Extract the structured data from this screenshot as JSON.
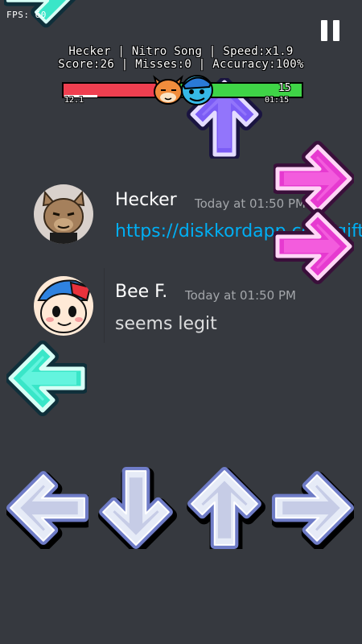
{
  "hud": {
    "fps": "FPS: 60",
    "line1": "Hecker | Nitro Song | Speed:x1.9",
    "line2": "Score:26 | Misses:0 | Accuracy:100%",
    "health_left_fraction": 0.39,
    "combo": "15",
    "left_small": "12.1",
    "time_remaining": "01:15",
    "song_progress_fraction": 0.14
  },
  "chat": {
    "messages": [
      {
        "author": "Hecker",
        "time": "Today at 01:50 PM",
        "text": "https://diskkordapp.com/gift"
      },
      {
        "author": "Bee F.",
        "time": "Today at 01:50 PM",
        "text": "seems legit"
      }
    ]
  },
  "colors": {
    "background": "#36393f",
    "receptor": "#e6ebf7",
    "receptor_outline": "#6f7cc7",
    "note_left": "#39e6c8",
    "note_up": "#7b5cf5",
    "note_right": "#e63ad0",
    "health_opponent": "#ef3f50",
    "health_player": "#3fd447",
    "link": "#00aff4"
  },
  "icons": {
    "pause": "pause-icon",
    "opponent": "cat-face-icon",
    "player": "boyfriend-face-icon"
  }
}
